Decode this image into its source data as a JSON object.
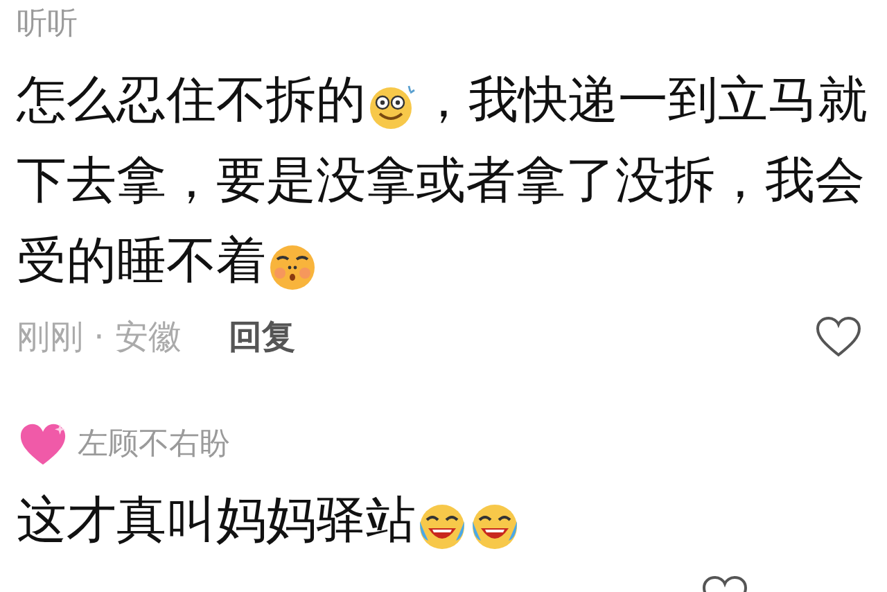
{
  "comments": [
    {
      "user": {
        "name": "听听"
      },
      "segments": [
        {
          "kind": "text",
          "text": "怎么忍住不拆的"
        },
        {
          "kind": "smile-emoji"
        },
        {
          "kind": "text",
          "text": "，我快递一到立马就下去拿，要是没拿或者拿了没拆，我会受的睡不着"
        },
        {
          "kind": "sleepy-emoji"
        }
      ],
      "meta": {
        "info": "刚刚 · 安徽",
        "reply": "回复"
      },
      "liked": false
    },
    {
      "user": {
        "name": "左顾不右盼",
        "kind": "emoji-prefixed"
      },
      "segments": [
        {
          "kind": "text",
          "text": "这才真叫妈妈驿站"
        },
        {
          "kind": "laugh-cry-emoji"
        },
        {
          "kind": "laugh-cry-emoji"
        }
      ],
      "liked": false
    }
  ]
}
